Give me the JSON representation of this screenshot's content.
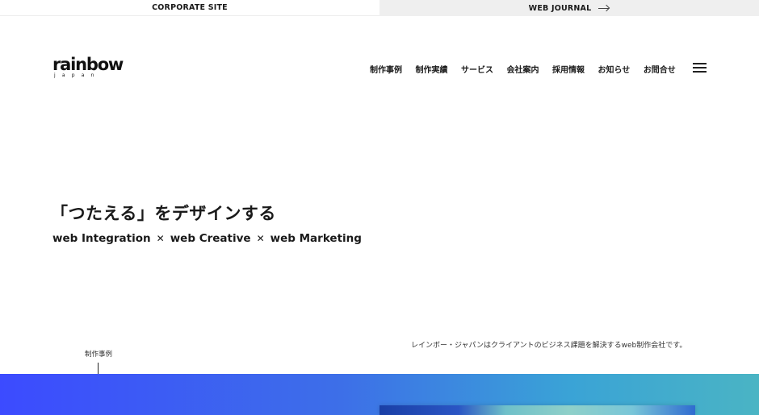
{
  "topbar": {
    "corporate_label": "CORPORATE SITE",
    "journal_label": "WEB JOURNAL"
  },
  "logo": {
    "word": "rainbow",
    "sub": "japan"
  },
  "nav": {
    "items": [
      "制作事例",
      "制作実績",
      "サービス",
      "会社案内",
      "採用情報",
      "お知らせ",
      "お問合せ"
    ]
  },
  "hero": {
    "headline": "「つたえる」をデザインする",
    "tagline_parts": [
      "web Integration",
      "web Creative",
      "web Marketing"
    ],
    "separator": "✕"
  },
  "works": {
    "label": "制作事例"
  },
  "intro": {
    "text": "レインボー・ジャパンはクライアントのビジネス課題を解決するweb制作会社です。"
  },
  "colors": {
    "gradient_start": "#3c4bff",
    "gradient_end": "#4ab4c4",
    "topbar_right_bg": "#efefef"
  }
}
